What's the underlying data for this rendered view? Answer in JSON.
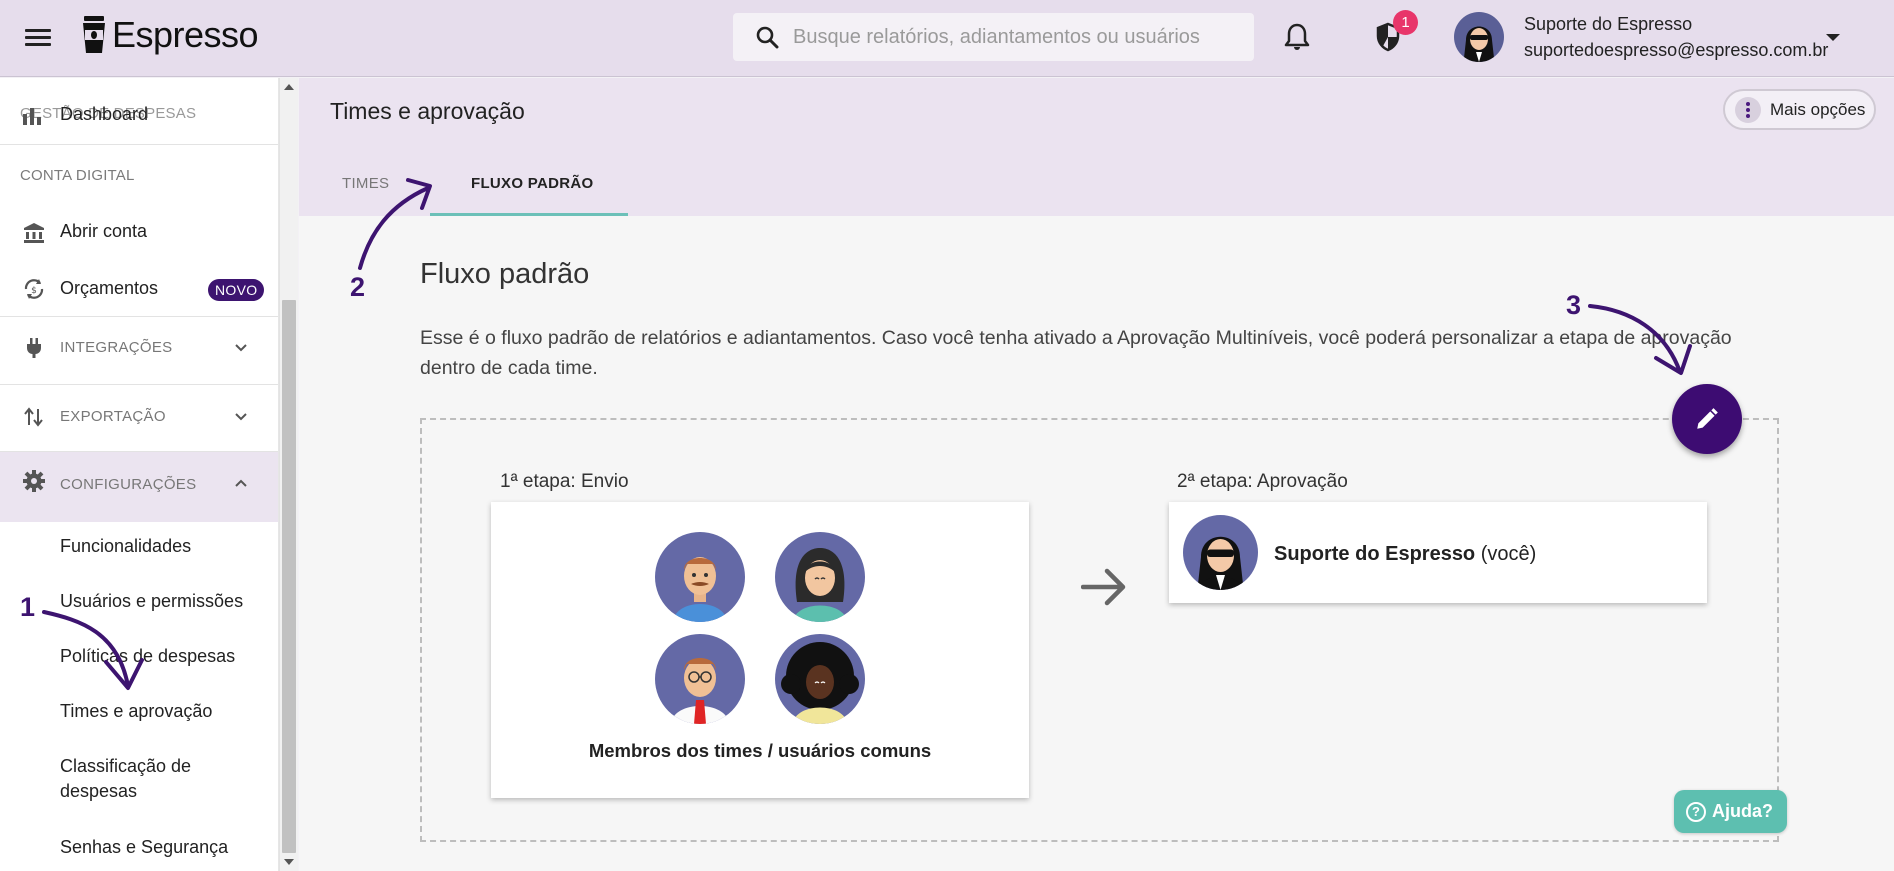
{
  "topbar": {
    "logo_text": "Espresso",
    "search_placeholder": "Busque relatórios, adiantamentos ou usuários",
    "notification_badge": "1",
    "user_name": "Suporte do Espresso",
    "user_email": "suportedoespresso@espresso.com.br"
  },
  "sidebar": {
    "overlap_section": "GESTÃO DE DESPESAS",
    "dashboard": "Dashboard",
    "section_conta": "CONTA DIGITAL",
    "abrir_conta": "Abrir conta",
    "orcamentos": "Orçamentos",
    "novo_badge": "NOVO",
    "integracoes": "INTEGRAÇÕES",
    "exportacao": "EXPORTAÇÃO",
    "configuracoes": "CONFIGURAÇÕES",
    "sub_items": [
      "Funcionalidades",
      "Usuários e permissões",
      "Políticas de despesas",
      "Times e aprovação",
      "Classificação de despesas",
      "Senhas e Segurança"
    ]
  },
  "main": {
    "page_title": "Times e aprovação",
    "more_options": "Mais opções",
    "tabs": [
      "TIMES",
      "FLUXO PADRÃO"
    ],
    "section_title": "Fluxo padrão",
    "description": "Esse é o fluxo padrão de relatórios e adiantamentos. Caso você tenha ativado a Aprovação Multiníveis, você poderá personalizar a etapa de aprovação dentro de cada time.",
    "stage1_label": "1ª etapa: Envio",
    "stage1_caption": "Membros dos times / usuários comuns",
    "stage2_label": "2ª etapa: Aprovação",
    "approver_name": "Suporte do Espresso",
    "approver_suffix": "(você)",
    "help": "Ajuda?"
  },
  "annotations": [
    "1",
    "2",
    "3"
  ],
  "colors": {
    "accent_purple": "#3d0c72",
    "header_bg": "#e6ddec",
    "tab_underline": "#6cc0b8",
    "help_button": "#5dbfb0",
    "badge_red": "#e8356a"
  }
}
